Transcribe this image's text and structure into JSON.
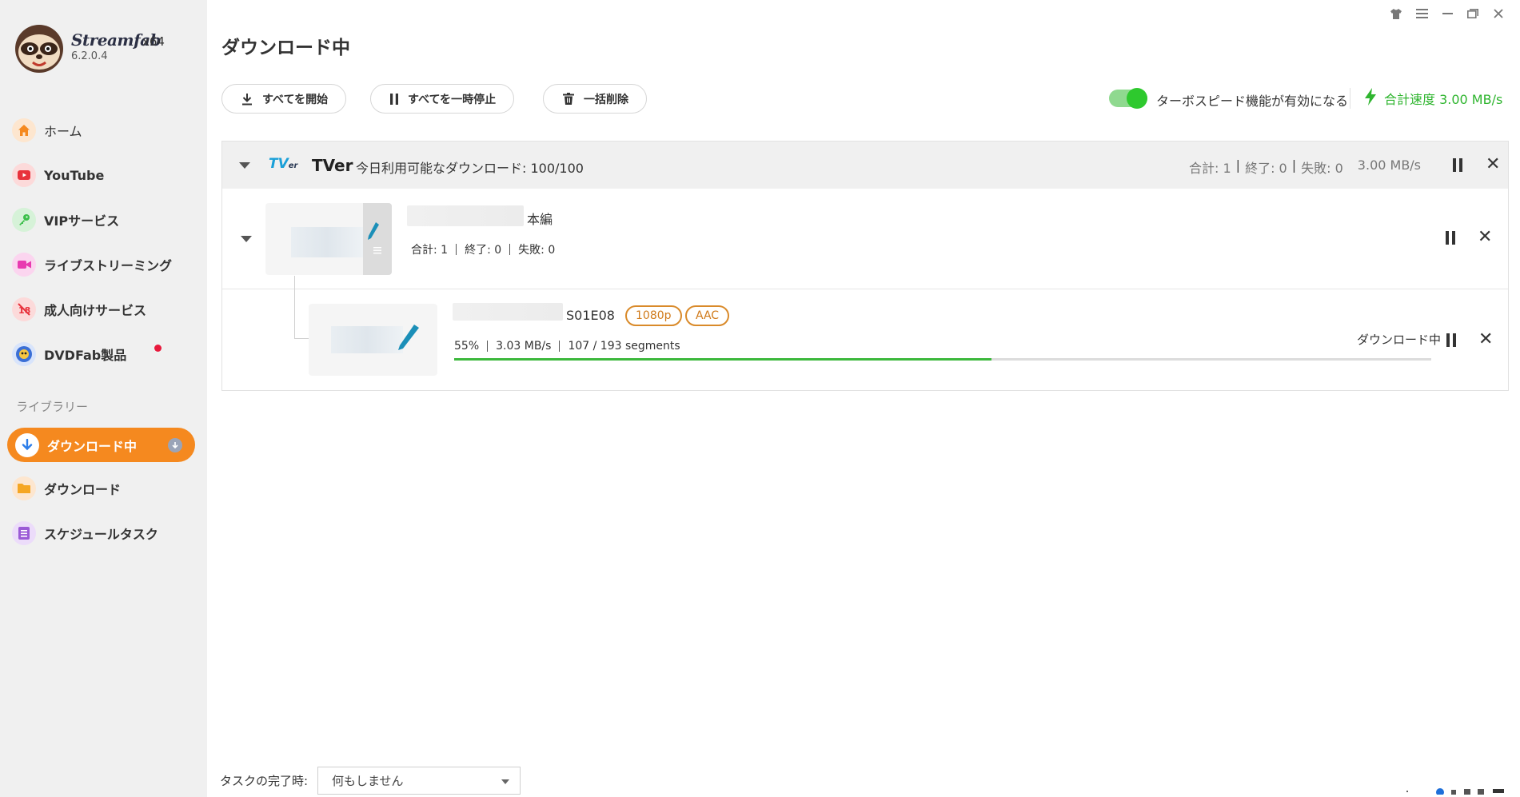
{
  "app": {
    "name": "Streamfab",
    "arch": "x64",
    "version": "6.2.0.4"
  },
  "sidebar": {
    "items": [
      {
        "label": "ホーム",
        "icon": "home-icon",
        "color": "#f5891f"
      },
      {
        "label": "YouTube",
        "icon": "youtube-icon",
        "color": "#e8323c"
      },
      {
        "label": "VIPサービス",
        "icon": "key-icon",
        "color": "#3bbf4a"
      },
      {
        "label": "ライブストリーミング",
        "icon": "video-camera-icon",
        "color": "#e83ab0"
      },
      {
        "label": "成人向けサービス",
        "icon": "adult-icon",
        "color": "#e8323c"
      },
      {
        "label": "DVDFab製品",
        "icon": "dvdfab-icon",
        "color": "#3b6fd6"
      }
    ],
    "library_title": "ライブラリー",
    "library": [
      {
        "label": "ダウンロード中",
        "icon": "download-arrow-icon",
        "active": true
      },
      {
        "label": "ダウンロード",
        "icon": "folder-icon",
        "color": "#f5a623"
      },
      {
        "label": "スケジュールタスク",
        "icon": "schedule-list-icon",
        "color": "#9b5bd6"
      }
    ]
  },
  "main": {
    "title": "ダウンロード中",
    "toolbar": {
      "start_all": "すべてを開始",
      "pause_all": "すべてを一時停止",
      "delete_all": "一括削除"
    },
    "turbo_label": "ターボスピード機能が有効になる",
    "turbo_enabled": true,
    "total_speed": "合計速度 3.00 MB/s",
    "accent_green": "#2fb52f"
  },
  "group": {
    "service": "TVer",
    "quota": "今日利用可能なダウンロード: 100/100",
    "stats": [
      "合計: 1",
      "終了: 0",
      "失敗: 0"
    ],
    "speed": "3.00 MB/s",
    "season": {
      "name": "本編",
      "stats": [
        "合計: 1",
        "終了: 0",
        "失敗: 0"
      ]
    },
    "episode": {
      "name": "S01E08",
      "tags": [
        "1080p",
        "AAC"
      ],
      "percent_text": "55%",
      "speed": "3.03 MB/s",
      "segments": "107 / 193 segments",
      "progress": 0.55,
      "status": "ダウンロード中"
    }
  },
  "footer": {
    "label": "タスクの完了時:",
    "select_value": "何もしません"
  }
}
